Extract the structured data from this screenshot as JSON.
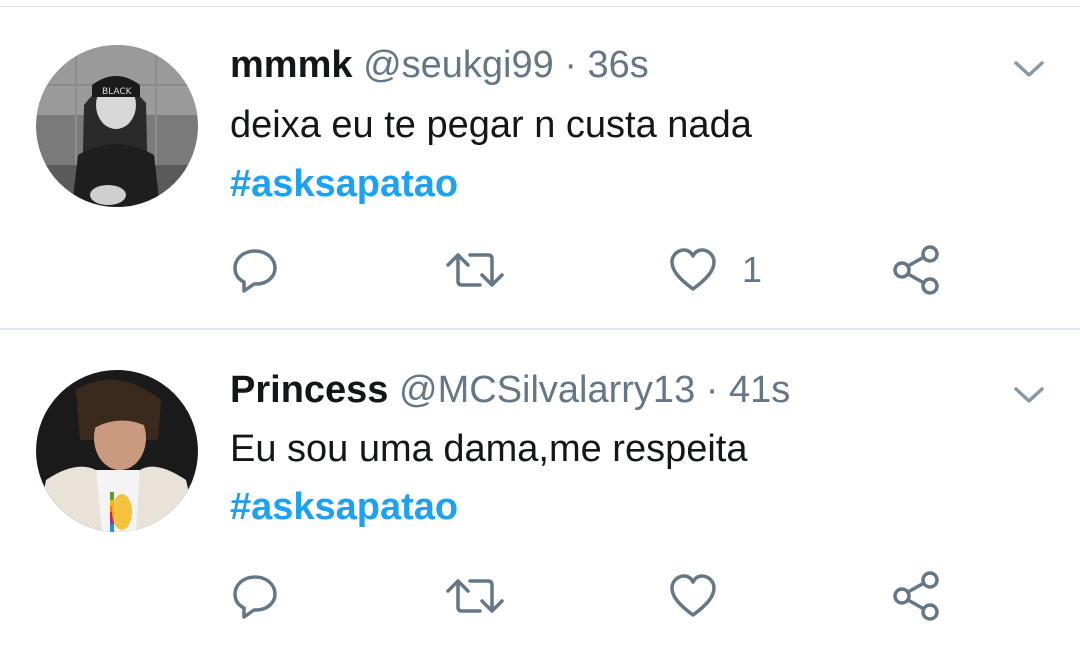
{
  "tweets": [
    {
      "name": "mmmk",
      "handle": "@seukgi99",
      "separator": "·",
      "time": "36s",
      "text": "deixa eu te pegar n custa nada",
      "hashtag": "#asksapatao",
      "like_count": "1",
      "avatar_icon": "avatar-photo-grayscale"
    },
    {
      "name": "Princess",
      "handle": "@MCSilvalarry13",
      "separator": "·",
      "time": "41s",
      "text": "Eu sou uma dama,me respeita",
      "hashtag": "#asksapatao",
      "like_count": "",
      "avatar_icon": "avatar-photo-color"
    }
  ],
  "actions": {
    "reply_icon": "reply-icon",
    "retweet_icon": "retweet-icon",
    "like_icon": "heart-icon",
    "share_icon": "share-icon",
    "menu_icon": "chevron-down-icon"
  },
  "colors": {
    "link": "#1da1f2",
    "muted": "#657786",
    "text": "#14171a",
    "divider": "#e1e8ed"
  }
}
